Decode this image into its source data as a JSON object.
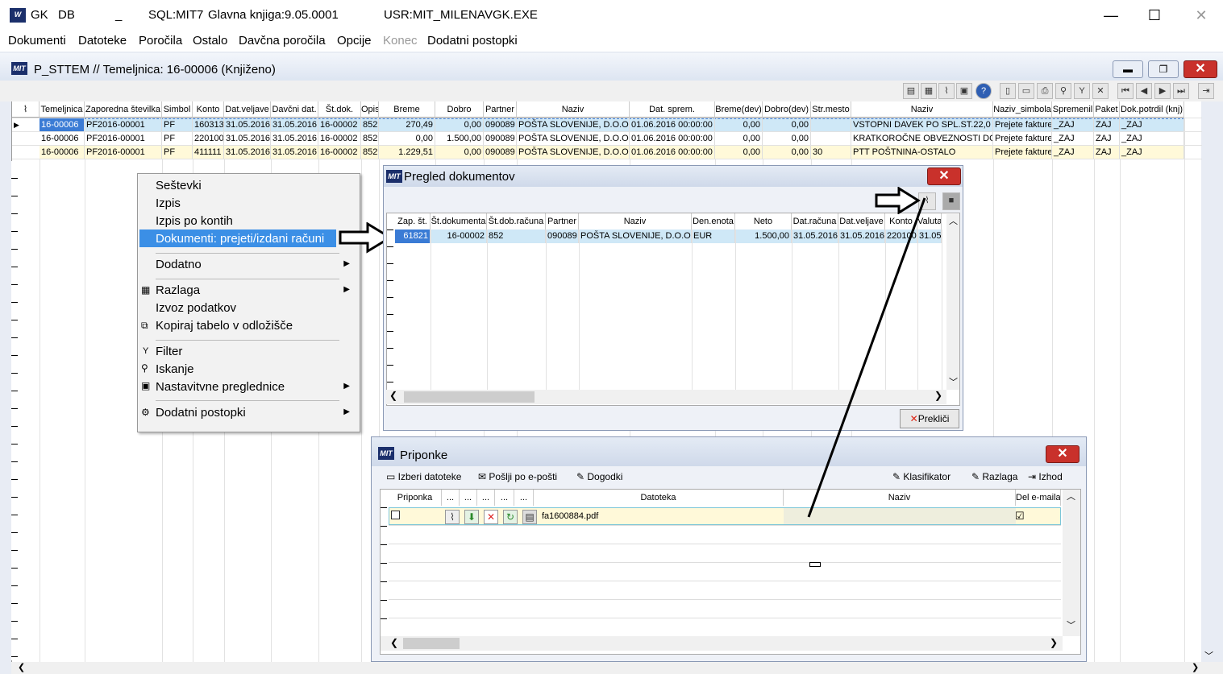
{
  "titlebar": {
    "app": "GK",
    "db": "DB",
    "underscore": "_",
    "sql": "SQL:MIT7",
    "ledger": "Glavna knjiga:9.05.0001",
    "user": "USR:MIT_MILENA",
    "exe": "VGK.EXE",
    "minimize": "—",
    "maximize": "☐",
    "close": "✕"
  },
  "menu": [
    "Dokumenti",
    "Datoteke",
    "Poročila",
    "Ostalo",
    "Davčna poročila",
    "Opcije",
    "Konec",
    "Dodatni postopki"
  ],
  "child": {
    "logo": "MIT",
    "title": "P_STTEM // Temeljnica: 16-00006  (Knjiženo)"
  },
  "grid": {
    "headers": [
      "Temeljnica",
      "Zaporedna številka",
      "Simbol",
      "Konto",
      "Dat.veljave",
      "Davčni dat.",
      "Št.dok.",
      "Opis",
      "Breme",
      "Dobro",
      "Partner",
      "Naziv",
      "Dat. sprem.",
      "Breme(dev)",
      "Dobro(dev)",
      "Str.mesto",
      "Naziv",
      "Naziv_simbola",
      "Spremenil",
      "Paket",
      "Dok.potrdil (knj)"
    ],
    "rows": [
      [
        "16-00006",
        "PF2016-00001",
        "PF",
        "160313",
        "31.05.2016",
        "31.05.2016",
        "16-00002",
        "852",
        "270,49",
        "0,00",
        "090089",
        "POŠTA SLOVENIJE, D.O.O.",
        "01.06.2016 00:00:00",
        "0,00",
        "0,00",
        "",
        "VSTOPNI DAVEK PO SPL.ST.22,0",
        "Prejete fakture",
        "_ZAJ",
        "ZAJ",
        "_ZAJ"
      ],
      [
        "16-00006",
        "PF2016-00001",
        "PF",
        "220100",
        "31.05.2016",
        "31.05.2016",
        "16-00002",
        "852",
        "0,00",
        "1.500,00",
        "090089",
        "POŠTA SLOVENIJE, D.O.O.",
        "01.06.2016 00:00:00",
        "0,00",
        "0,00",
        "",
        "KRATKOROČNE OBVEZNOSTI DO",
        "Prejete fakture",
        "_ZAJ",
        "ZAJ",
        "_ZAJ"
      ],
      [
        "16-00006",
        "PF2016-00001",
        "PF",
        "411111",
        "31.05.2016",
        "31.05.2016",
        "16-00002",
        "852",
        "1.229,51",
        "0,00",
        "090089",
        "POŠTA SLOVENIJE, D.O.O.",
        "01.06.2016 00:00:00",
        "0,00",
        "0,00",
        "30",
        "PTT POŠTNINA-OSTALO",
        "Prejete fakture",
        "_ZAJ",
        "ZAJ",
        "_ZAJ"
      ]
    ]
  },
  "context_menu": {
    "items": [
      "Seštevki",
      "Izpis",
      "Izpis po kontih",
      "Dokumenti: prejeti/izdani računi",
      "Dodatno",
      "Razlaga",
      "Izvoz podatkov",
      "Kopiraj tabelo v odložišče",
      "Filter",
      "Iskanje",
      "Nastavitvne preglednice",
      "Dodatni postopki"
    ]
  },
  "pregled": {
    "title": "Pregled dokumentov",
    "headers": [
      "Zap. št.",
      "Št.dokumenta",
      "Št.dob.računa",
      "Partner",
      "Naziv",
      "Den.enota",
      "Neto",
      "Dat.računa",
      "Dat.veljave",
      "Konto",
      "Valuta"
    ],
    "row": [
      "61821",
      "16-00002",
      "852",
      "090089",
      "POŠTA SLOVENIJE, D.O.O.",
      "EUR",
      "1.500,00",
      "31.05.2016",
      "31.05.2016",
      "220100",
      "31.05"
    ],
    "cancel": "Prekliči",
    "cancel_icon": "✕"
  },
  "priponke": {
    "title": "Priponke",
    "toolbar": [
      "Izberi datoteke",
      "Pošlji po e-pošti",
      "Dogodki",
      "Klasifikator",
      "Razlaga",
      "Izhod"
    ],
    "headers": [
      "Priponka",
      "...",
      "...",
      "...",
      "...",
      "...",
      "Datoteka",
      "Naziv",
      "Del e-maila"
    ],
    "row": {
      "file": "fa1600884.pdf",
      "email_checked": "☑"
    }
  }
}
